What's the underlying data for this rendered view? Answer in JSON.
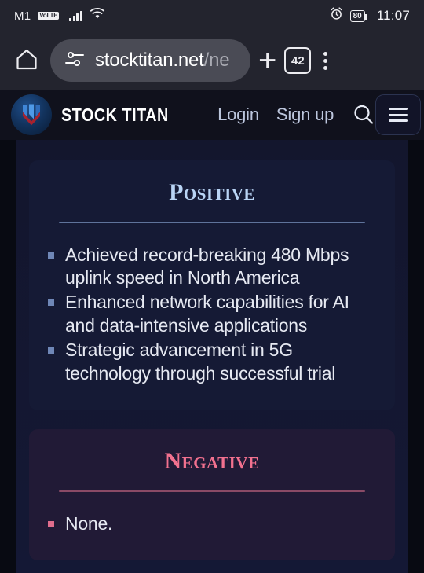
{
  "statusbar": {
    "carrier": "M1",
    "volte_badge": "VoLTE",
    "signal_icon": "signal-bars-icon",
    "wifi_icon": "wifi-icon",
    "alarm_icon": "alarm-clock-icon",
    "battery_level": "80",
    "time": "11:07"
  },
  "browser": {
    "home_icon": "home-icon",
    "site_settings_icon": "tune-icon",
    "url_host": "stocktitan.net",
    "url_path": "/ne",
    "new_tab_icon": "plus-icon",
    "tab_count": "42",
    "overflow_icon": "three-dot-menu-icon"
  },
  "site_header": {
    "logo_icon": "stock-titan-logo-icon",
    "brand": "STOCK TITAN",
    "login_label": "Login",
    "signup_label": "Sign up",
    "search_icon": "search-icon",
    "menu_icon": "hamburger-menu-icon"
  },
  "cards": [
    {
      "id": "positive",
      "title": "Positive",
      "accent": "#b9d4f5",
      "items": [
        "Achieved record-breaking 480 Mbps uplink speed in North America",
        "Enhanced network capabilities for AI and data-intensive applications",
        "Strategic advancement in 5G technology through successful trial"
      ]
    },
    {
      "id": "negative",
      "title": "Negative",
      "accent": "#f2718f",
      "items": [
        "None."
      ]
    }
  ]
}
